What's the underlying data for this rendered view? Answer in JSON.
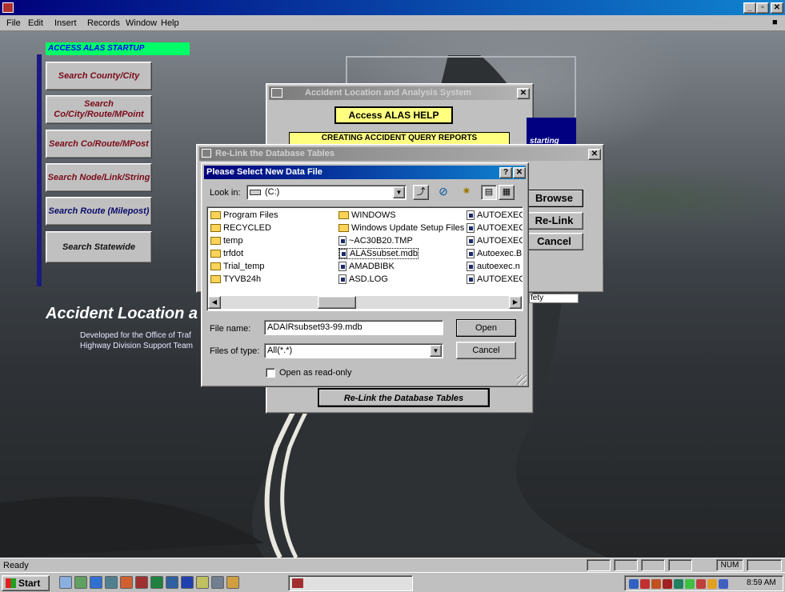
{
  "app": {
    "title": ""
  },
  "menu": {
    "items": [
      "File",
      "Edit",
      "Insert",
      "Records",
      "Window",
      "Help"
    ]
  },
  "startup": {
    "banner": "ACCESS ALAS STARTUP",
    "buttons": [
      "Search County/City",
      "Search Co/City/Route/MPoint",
      "Search Co/Route/MPost",
      "Search Node/Link/String",
      "Search Route (Milepost)",
      "Search Statewide"
    ],
    "heading": "Accident Location and",
    "subtext1": "Developed for the Office of Traf",
    "subtext2": "Highway Division Support Team"
  },
  "alas_window": {
    "title": "Accident Location and Analysis System",
    "help_button": "Access ALAS HELP",
    "reports_button": "CREATING ACCIDENT QUERY REPORTS",
    "starting_label": "starting",
    "safety_label": "fety",
    "relink_button": "Re-Link the Database Tables"
  },
  "relink_window": {
    "title": "Re-Link the Database Tables",
    "browse": "Browse",
    "relink": "Re-Link",
    "cancel": "Cancel"
  },
  "file_dialog": {
    "title": "Please Select New Data File",
    "help_btn": "?",
    "close_btn": "✕",
    "look_in_label": "Look in:",
    "look_in_value": "(C:)",
    "files": [
      {
        "name": "Program Files",
        "type": "folder"
      },
      {
        "name": "RECYCLED",
        "type": "folder"
      },
      {
        "name": "temp",
        "type": "folder"
      },
      {
        "name": "trfdot",
        "type": "folder"
      },
      {
        "name": "Trial_temp",
        "type": "folder"
      },
      {
        "name": "TYVB24h",
        "type": "folder"
      },
      {
        "name": "WINDOWS",
        "type": "folder"
      },
      {
        "name": "Windows Update Setup Files",
        "type": "folder"
      },
      {
        "name": "~AC30B20.TMP",
        "type": "file"
      },
      {
        "name": "ALASsubset.mdb",
        "type": "file"
      },
      {
        "name": "AMADBIBK",
        "type": "file"
      },
      {
        "name": "ASD.LOG",
        "type": "file"
      },
      {
        "name": "AUTOEXEC",
        "type": "file"
      },
      {
        "name": "AUTOEXEC",
        "type": "file"
      },
      {
        "name": "AUTOEXEC",
        "type": "file"
      },
      {
        "name": "Autoexec.B",
        "type": "file"
      },
      {
        "name": "autoexec.n",
        "type": "file"
      },
      {
        "name": "AUTOEXEC",
        "type": "file"
      }
    ],
    "file_name_label": "File name:",
    "file_name_value": "ADAIRsubset93-99.mdb",
    "files_type_label": "Files of type:",
    "files_type_value": "All(*.*)",
    "open": "Open",
    "cancel": "Cancel",
    "open_readonly": "Open as read-only"
  },
  "status": {
    "text": "Ready",
    "num": "NUM"
  },
  "taskbar": {
    "start": "Start",
    "clock": "8:59 AM"
  },
  "colors": {
    "title_active": "#00007b",
    "banner_bg": "#00ff66",
    "banner_text": "#0000ff",
    "yellow": "#ffff80"
  }
}
